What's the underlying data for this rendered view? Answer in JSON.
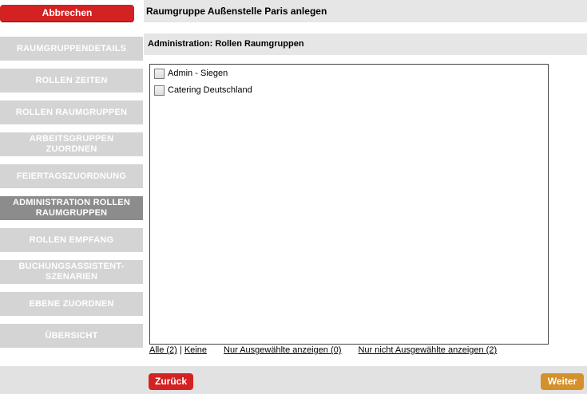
{
  "actions": {
    "cancel_label": "Abbrechen",
    "back_label": "Zurück",
    "next_label": "Weiter"
  },
  "header": {
    "title": "Raumgruppe Außenstelle Paris anlegen",
    "section_title": "Administration: Rollen Raumgruppen"
  },
  "sidebar": {
    "items": [
      {
        "label": "RAUMGRUPPENDETAILS"
      },
      {
        "label": "ROLLEN ZEITEN"
      },
      {
        "label": "ROLLEN RAUMGRUPPEN"
      },
      {
        "label": "ARBEITSGRUPPEN ZUORDNEN"
      },
      {
        "label": "FEIERTAGSZUORDNUNG"
      },
      {
        "label": "ADMINISTRATION ROLLEN RAUMGRUPPEN",
        "active": true
      },
      {
        "label": "ROLLEN EMPFANG"
      },
      {
        "label": "BUCHUNGSASSISTENT-SZENARIEN"
      },
      {
        "label": "EBENE ZUORDNEN"
      },
      {
        "label": "ÜBERSICHT"
      }
    ]
  },
  "list": {
    "items": [
      {
        "label": "Admin - Siegen",
        "checked": false
      },
      {
        "label": "Catering Deutschland",
        "checked": false
      }
    ]
  },
  "filters": {
    "all_label": "Alle (2)",
    "separator": "|",
    "none_label": "Keine",
    "show_selected_label": "Nur Ausgewählte anzeigen (0)",
    "show_unselected_label": "Nur nicht Ausgewählte anzeigen (2)"
  },
  "colors": {
    "primary_red": "#d42222",
    "next_orange": "#d4902a",
    "nav_inactive": "#d4d4d4",
    "nav_active": "#8c8c8c",
    "bar_gray": "#e6e6e6"
  }
}
